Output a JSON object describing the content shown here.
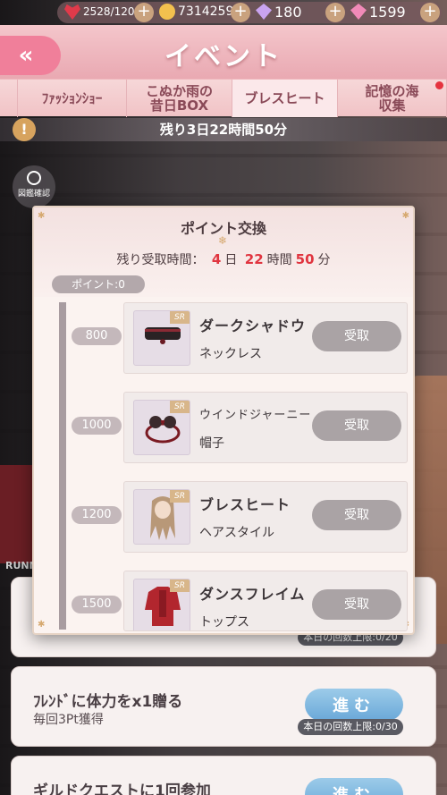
{
  "resources": {
    "stamina": "2528/120",
    "gold": "7314259",
    "diamond": "180",
    "pink_diamond": "1599"
  },
  "header": {
    "back_label": "«",
    "title": "イベント"
  },
  "tabs": [
    {
      "label": "",
      "active": false
    },
    {
      "label": "ﾌｧｯｼｮﾝｼｮｰ",
      "active": false
    },
    {
      "label": "こぬか雨の\n昔日BOX",
      "active": false
    },
    {
      "label": "ブレスヒート",
      "active": true
    },
    {
      "label": "記憶の海\n収集",
      "active": false
    }
  ],
  "event_countdown": "残り3日22時間50分",
  "alert_symbol": "!",
  "zukan_label": "図鑑確認",
  "background_text": "RUNN",
  "modal": {
    "title": "ポイント交換",
    "remain_label": "残り受取時間：",
    "remain_days": "4",
    "remain_day_unit": "日",
    "remain_hours": "22",
    "remain_hour_unit": "時間",
    "remain_minutes": "50",
    "remain_minute_unit": "分",
    "points_label": "ポイント:0",
    "rewards": [
      {
        "points": "800",
        "name": "ダークシャドウ",
        "category": "ネックレス",
        "rarity": "SR",
        "claim": "受取"
      },
      {
        "points": "1000",
        "name": "ウインドジャーニー",
        "category": "帽子",
        "rarity": "SR",
        "claim": "受取"
      },
      {
        "points": "1200",
        "name": "ブレスヒート",
        "category": "ヘアスタイル",
        "rarity": "SR",
        "claim": "受取"
      },
      {
        "points": "1500",
        "name": "ダンスフレイム",
        "category": "トップス",
        "rarity": "SR",
        "claim": "受取"
      }
    ]
  },
  "tasks": [
    {
      "name": "",
      "sub": "",
      "button": "",
      "limit": "本日の回数上限:0/20"
    },
    {
      "name": "ﾌﾚﾝﾄﾞに体力をx1贈る",
      "sub": "毎回3Pt獲得",
      "button": "進む",
      "limit": "本日の回数上限:0/30"
    },
    {
      "name": "ギルドクエストに1回参加",
      "sub": "",
      "button": "進む",
      "limit": ""
    }
  ],
  "colors": {
    "accent_pink": "#f07f9a",
    "countdown_red": "#e0343f",
    "go_button_blue": "#6aa8d8"
  }
}
